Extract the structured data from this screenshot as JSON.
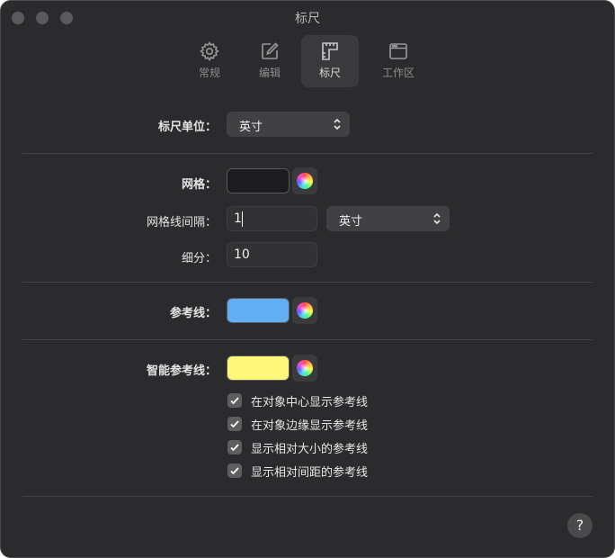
{
  "window": {
    "title": "标尺"
  },
  "toolbar": {
    "tabs": [
      {
        "label": "常规",
        "icon": "gear-icon"
      },
      {
        "label": "编辑",
        "icon": "edit-icon"
      },
      {
        "label": "标尺",
        "icon": "ruler-icon",
        "active": true
      },
      {
        "label": "工作区",
        "icon": "window-icon"
      }
    ]
  },
  "ruler_units": {
    "label": "标尺单位：",
    "value": "英寸"
  },
  "grid": {
    "label": "网格：",
    "color": "#1c1c1e"
  },
  "grid_spacing": {
    "label": "网格线间隔：",
    "value": "1",
    "unit": "英寸"
  },
  "subdivisions": {
    "label": "细分：",
    "value": "10"
  },
  "guides": {
    "label": "参考线：",
    "color": "#62aef2"
  },
  "smart_guides": {
    "label": "智能参考线：",
    "color": "#fff77a",
    "options": [
      {
        "label": "在对象中心显示参考线",
        "checked": true
      },
      {
        "label": "在对象边缘显示参考线",
        "checked": true
      },
      {
        "label": "显示相对大小的参考线",
        "checked": true
      },
      {
        "label": "显示相对间距的参考线",
        "checked": true
      }
    ]
  },
  "help": {
    "label": "?"
  }
}
